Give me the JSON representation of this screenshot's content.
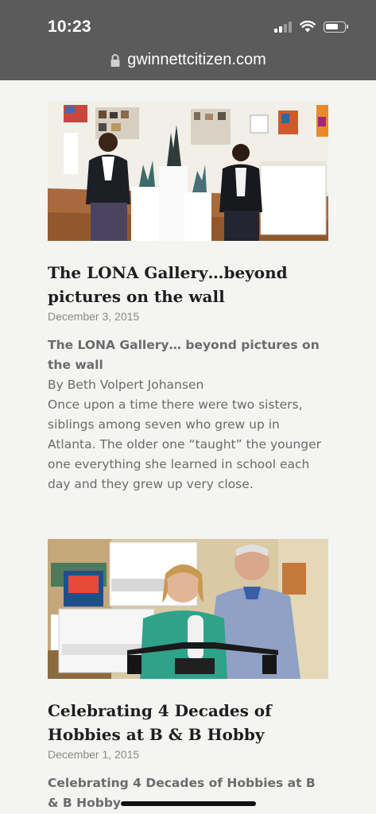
{
  "status_bar": {
    "time": "10:23"
  },
  "browser": {
    "url": "gwinnettcitizen.com"
  },
  "articles": [
    {
      "image_alt": "Two women standing in an art gallery",
      "title": "The LONA Gallery…beyond pictures on the wall",
      "date": "December 3, 2015",
      "subhead": "The LONA Gallery… beyond pictures on the wall",
      "byline": "By Beth Volpert Johansen",
      "excerpt": "Once upon a time there were two sisters, siblings among seven who grew up in Atlanta. The older one “taught” the younger one everything she learned in school each day and they grew up very close."
    },
    {
      "image_alt": "A woman and a man holding a drone in a hobby shop",
      "title": "Celebrating 4 Decades of Hobbies at B & B Hobby",
      "date": "December 1, 2015",
      "subhead": "Celebrating 4 Decades of Hobbies at B & B Hobby"
    }
  ]
}
